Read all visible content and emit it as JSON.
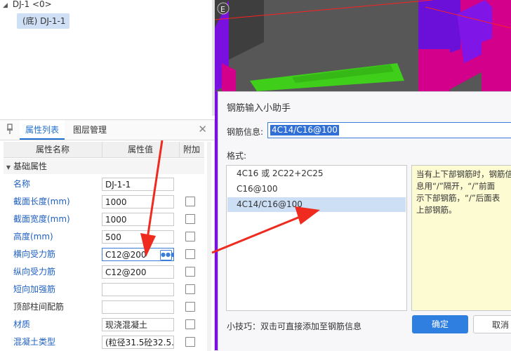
{
  "tree": {
    "root_label": "DJ-1 <0>",
    "child_label": "(底) DJ-1-1"
  },
  "property_panel": {
    "tabs": [
      "属性列表",
      "图层管理"
    ],
    "columns": {
      "name": "属性名称",
      "value": "属性值",
      "extra": "附加"
    },
    "group_label": "基础属性",
    "rows": [
      {
        "name": "名称",
        "value": "DJ-1-1",
        "checkbox": false
      },
      {
        "name": "截面长度(mm)",
        "value": "1000",
        "checkbox": true
      },
      {
        "name": "截面宽度(mm)",
        "value": "1000",
        "checkbox": true
      },
      {
        "name": "高度(mm)",
        "value": "500",
        "checkbox": true
      },
      {
        "name": "横向受力筋",
        "value": "C12@200",
        "checkbox": true
      },
      {
        "name": "纵向受力筋",
        "value": "C12@200",
        "checkbox": true
      },
      {
        "name": "短向加强筋",
        "value": "",
        "checkbox": true
      },
      {
        "name": "顶部柱间配筋",
        "value": "",
        "checkbox": true
      },
      {
        "name": "材质",
        "value": "现浇混凝土",
        "checkbox": true
      },
      {
        "name": "混凝土类型",
        "value": "(粒径31.5砼32.5...",
        "checkbox": true
      }
    ]
  },
  "dialog": {
    "title": "钢筋输入小助手",
    "info_label": "钢筋信息:",
    "info_value": "4C14/C16@100",
    "format_label": "格式:",
    "format_items": [
      "4C16 或 2C22+2C25",
      "C16@100",
      "4C14/C16@100"
    ],
    "selected_format_index": 2,
    "hint_lines": [
      "当有上下部钢筋时，钢筋信",
      "息用“/”隔开，“/”前面",
      "示下部钢筋，“/”后面表",
      "上部钢筋。"
    ],
    "tip": "小技巧：双击可直接添加至钢筋信息",
    "ok_label": "确定",
    "cancel_label": "取消"
  },
  "viewport": {
    "corner_label": "E"
  },
  "colors": {
    "accent": "#1f6fd0",
    "selection": "#cddff5",
    "ok_button": "#2f7fe0",
    "arrow": "#ef2b1f",
    "viewport_magenta": "#d2008a",
    "viewport_purple": "#7a10e0",
    "viewport_green": "#3fcf1a",
    "hint_background": "#fdfbd2"
  }
}
